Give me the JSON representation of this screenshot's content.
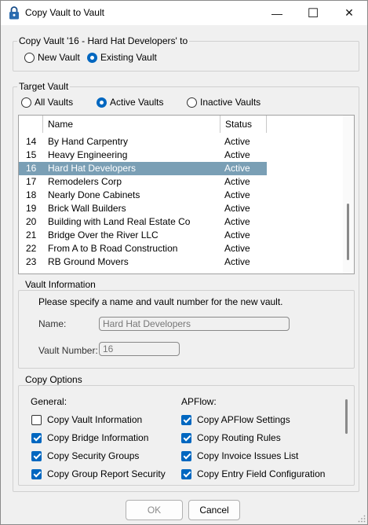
{
  "window": {
    "title": "Copy Vault to Vault",
    "min_glyph": "—",
    "max_glyph": "☐",
    "close_glyph": "✕"
  },
  "copy_section": {
    "title": "Copy Vault '16 - Hard Hat Developers' to",
    "new_vault_label": "New Vault",
    "existing_vault_label": "Existing Vault",
    "selected": "existing"
  },
  "target_vault": {
    "title": "Target Vault",
    "filters": [
      "All Vaults",
      "Active Vaults",
      "Inactive Vaults"
    ],
    "selected_filter": "Active Vaults",
    "columns": [
      "",
      "Name",
      "Status"
    ],
    "rows": [
      {
        "num": "14",
        "name": "By Hand Carpentry",
        "status": "Active"
      },
      {
        "num": "15",
        "name": "Heavy Engineering",
        "status": "Active"
      },
      {
        "num": "16",
        "name": "Hard Hat Developers",
        "status": "Active"
      },
      {
        "num": "17",
        "name": "Remodelers Corp",
        "status": "Active"
      },
      {
        "num": "18",
        "name": "Nearly Done Cabinets",
        "status": "Active"
      },
      {
        "num": "19",
        "name": "Brick Wall Builders",
        "status": "Active"
      },
      {
        "num": "20",
        "name": "Building with Land Real Estate Co",
        "status": "Active"
      },
      {
        "num": "21",
        "name": "Bridge Over the River LLC",
        "status": "Active"
      },
      {
        "num": "22",
        "name": "From A to B Road Construction",
        "status": "Active"
      },
      {
        "num": "23",
        "name": "RB Ground Movers",
        "status": "Active"
      }
    ],
    "selected_row": "16"
  },
  "vault_info": {
    "title": "Vault Information",
    "instructions": "Please specify a name and vault number for the new vault.",
    "name_label": "Name:",
    "name_value": "Hard Hat Developers",
    "number_label": "Vault Number:",
    "number_value": "16"
  },
  "copy_options": {
    "title": "Copy Options",
    "general_header": "General:",
    "apflow_header": "APFlow:",
    "general": [
      {
        "label": "Copy Vault Information",
        "checked": false
      },
      {
        "label": "Copy Bridge Information",
        "checked": true
      },
      {
        "label": "Copy Security Groups",
        "checked": true
      },
      {
        "label": "Copy Group Report Security",
        "checked": true
      }
    ],
    "apflow": [
      {
        "label": "Copy APFlow Settings",
        "checked": true
      },
      {
        "label": "Copy Routing Rules",
        "checked": true
      },
      {
        "label": "Copy Invoice Issues List",
        "checked": true
      },
      {
        "label": "Copy Entry Field Configuration",
        "checked": true
      }
    ]
  },
  "buttons": {
    "ok": "OK",
    "cancel": "Cancel"
  }
}
